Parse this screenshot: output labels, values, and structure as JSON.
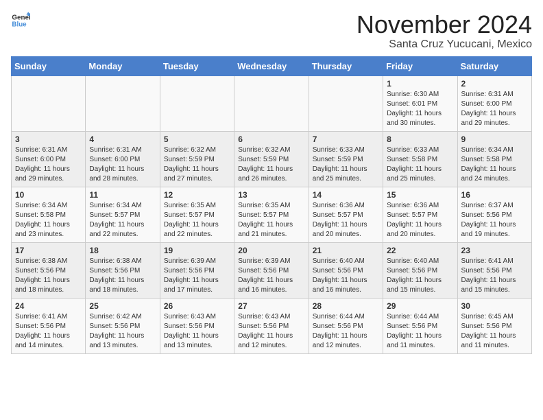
{
  "header": {
    "logo_general": "General",
    "logo_blue": "Blue",
    "month_title": "November 2024",
    "location": "Santa Cruz Yucucani, Mexico"
  },
  "weekdays": [
    "Sunday",
    "Monday",
    "Tuesday",
    "Wednesday",
    "Thursday",
    "Friday",
    "Saturday"
  ],
  "weeks": [
    [
      {
        "day": "",
        "info": ""
      },
      {
        "day": "",
        "info": ""
      },
      {
        "day": "",
        "info": ""
      },
      {
        "day": "",
        "info": ""
      },
      {
        "day": "",
        "info": ""
      },
      {
        "day": "1",
        "info": "Sunrise: 6:30 AM\nSunset: 6:01 PM\nDaylight: 11 hours and 30 minutes."
      },
      {
        "day": "2",
        "info": "Sunrise: 6:31 AM\nSunset: 6:00 PM\nDaylight: 11 hours and 29 minutes."
      }
    ],
    [
      {
        "day": "3",
        "info": "Sunrise: 6:31 AM\nSunset: 6:00 PM\nDaylight: 11 hours and 29 minutes."
      },
      {
        "day": "4",
        "info": "Sunrise: 6:31 AM\nSunset: 6:00 PM\nDaylight: 11 hours and 28 minutes."
      },
      {
        "day": "5",
        "info": "Sunrise: 6:32 AM\nSunset: 5:59 PM\nDaylight: 11 hours and 27 minutes."
      },
      {
        "day": "6",
        "info": "Sunrise: 6:32 AM\nSunset: 5:59 PM\nDaylight: 11 hours and 26 minutes."
      },
      {
        "day": "7",
        "info": "Sunrise: 6:33 AM\nSunset: 5:59 PM\nDaylight: 11 hours and 25 minutes."
      },
      {
        "day": "8",
        "info": "Sunrise: 6:33 AM\nSunset: 5:58 PM\nDaylight: 11 hours and 25 minutes."
      },
      {
        "day": "9",
        "info": "Sunrise: 6:34 AM\nSunset: 5:58 PM\nDaylight: 11 hours and 24 minutes."
      }
    ],
    [
      {
        "day": "10",
        "info": "Sunrise: 6:34 AM\nSunset: 5:58 PM\nDaylight: 11 hours and 23 minutes."
      },
      {
        "day": "11",
        "info": "Sunrise: 6:34 AM\nSunset: 5:57 PM\nDaylight: 11 hours and 22 minutes."
      },
      {
        "day": "12",
        "info": "Sunrise: 6:35 AM\nSunset: 5:57 PM\nDaylight: 11 hours and 22 minutes."
      },
      {
        "day": "13",
        "info": "Sunrise: 6:35 AM\nSunset: 5:57 PM\nDaylight: 11 hours and 21 minutes."
      },
      {
        "day": "14",
        "info": "Sunrise: 6:36 AM\nSunset: 5:57 PM\nDaylight: 11 hours and 20 minutes."
      },
      {
        "day": "15",
        "info": "Sunrise: 6:36 AM\nSunset: 5:57 PM\nDaylight: 11 hours and 20 minutes."
      },
      {
        "day": "16",
        "info": "Sunrise: 6:37 AM\nSunset: 5:56 PM\nDaylight: 11 hours and 19 minutes."
      }
    ],
    [
      {
        "day": "17",
        "info": "Sunrise: 6:38 AM\nSunset: 5:56 PM\nDaylight: 11 hours and 18 minutes."
      },
      {
        "day": "18",
        "info": "Sunrise: 6:38 AM\nSunset: 5:56 PM\nDaylight: 11 hours and 18 minutes."
      },
      {
        "day": "19",
        "info": "Sunrise: 6:39 AM\nSunset: 5:56 PM\nDaylight: 11 hours and 17 minutes."
      },
      {
        "day": "20",
        "info": "Sunrise: 6:39 AM\nSunset: 5:56 PM\nDaylight: 11 hours and 16 minutes."
      },
      {
        "day": "21",
        "info": "Sunrise: 6:40 AM\nSunset: 5:56 PM\nDaylight: 11 hours and 16 minutes."
      },
      {
        "day": "22",
        "info": "Sunrise: 6:40 AM\nSunset: 5:56 PM\nDaylight: 11 hours and 15 minutes."
      },
      {
        "day": "23",
        "info": "Sunrise: 6:41 AM\nSunset: 5:56 PM\nDaylight: 11 hours and 15 minutes."
      }
    ],
    [
      {
        "day": "24",
        "info": "Sunrise: 6:41 AM\nSunset: 5:56 PM\nDaylight: 11 hours and 14 minutes."
      },
      {
        "day": "25",
        "info": "Sunrise: 6:42 AM\nSunset: 5:56 PM\nDaylight: 11 hours and 13 minutes."
      },
      {
        "day": "26",
        "info": "Sunrise: 6:43 AM\nSunset: 5:56 PM\nDaylight: 11 hours and 13 minutes."
      },
      {
        "day": "27",
        "info": "Sunrise: 6:43 AM\nSunset: 5:56 PM\nDaylight: 11 hours and 12 minutes."
      },
      {
        "day": "28",
        "info": "Sunrise: 6:44 AM\nSunset: 5:56 PM\nDaylight: 11 hours and 12 minutes."
      },
      {
        "day": "29",
        "info": "Sunrise: 6:44 AM\nSunset: 5:56 PM\nDaylight: 11 hours and 11 minutes."
      },
      {
        "day": "30",
        "info": "Sunrise: 6:45 AM\nSunset: 5:56 PM\nDaylight: 11 hours and 11 minutes."
      }
    ]
  ]
}
